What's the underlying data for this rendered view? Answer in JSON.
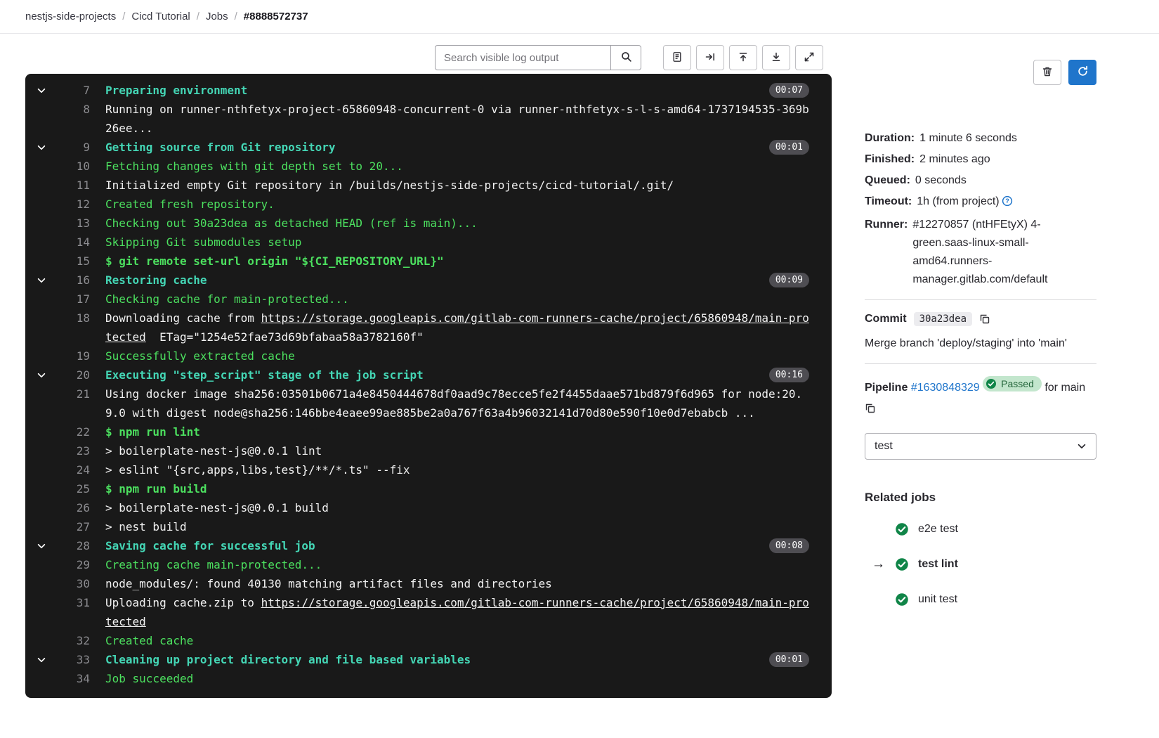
{
  "breadcrumb": {
    "items": [
      "nestjs-side-projects",
      "Cicd Tutorial",
      "Jobs"
    ],
    "current": "#8888572737",
    "separator": "/"
  },
  "log_toolbar": {
    "search_placeholder": "Search visible log output",
    "search_button_icon": "search-icon",
    "buttons": [
      {
        "name": "raw-log-button",
        "icon": "document-icon"
      },
      {
        "name": "show-complete-raw-button",
        "icon": "arrow-to-end-icon"
      },
      {
        "name": "scroll-to-top-button",
        "icon": "scroll-to-top-icon"
      },
      {
        "name": "scroll-to-bottom-button",
        "icon": "scroll-to-bottom-icon"
      },
      {
        "name": "fullscreen-button",
        "icon": "fullscreen-icon"
      }
    ]
  },
  "log": {
    "lines": [
      {
        "num": "7",
        "section": true,
        "duration": "00:07",
        "segments": [
          {
            "t": "Preparing environment",
            "s": "section"
          }
        ]
      },
      {
        "num": "8",
        "segments": [
          {
            "t": "Running on runner-nthfetyx-project-65860948-concurrent-0 via runner-nthfetyx-s-l-s-amd64-1737194535-369b26ee...",
            "s": "plain"
          }
        ]
      },
      {
        "num": "9",
        "section": true,
        "duration": "00:01",
        "segments": [
          {
            "t": "Getting source from Git repository",
            "s": "section"
          }
        ]
      },
      {
        "num": "10",
        "segments": [
          {
            "t": "Fetching changes with git depth set to 20...",
            "s": "green"
          }
        ]
      },
      {
        "num": "11",
        "segments": [
          {
            "t": "Initialized empty Git repository in /builds/nestjs-side-projects/cicd-tutorial/.git/",
            "s": "plain"
          }
        ]
      },
      {
        "num": "12",
        "segments": [
          {
            "t": "Created fresh repository.",
            "s": "green"
          }
        ]
      },
      {
        "num": "13",
        "segments": [
          {
            "t": "Checking out 30a23dea as detached HEAD (ref is main)...",
            "s": "green"
          }
        ]
      },
      {
        "num": "14",
        "segments": [
          {
            "t": "Skipping Git submodules setup",
            "s": "green"
          }
        ]
      },
      {
        "num": "15",
        "segments": [
          {
            "t": "$ git remote set-url origin \"${CI_REPOSITORY_URL}\"",
            "s": "cmd"
          }
        ]
      },
      {
        "num": "16",
        "section": true,
        "duration": "00:09",
        "segments": [
          {
            "t": "Restoring cache",
            "s": "section"
          }
        ]
      },
      {
        "num": "17",
        "segments": [
          {
            "t": "Checking cache for main-protected...",
            "s": "green"
          }
        ]
      },
      {
        "num": "18",
        "segments": [
          {
            "t": "Downloading cache from ",
            "s": "plain"
          },
          {
            "t": "https://storage.googleapis.com/gitlab-com-runners-cache/project/65860948/main-protected",
            "s": "link"
          },
          {
            "t": "  ETag=\"1254e52fae73d69bfabaa58a3782160f\"",
            "s": "plain"
          }
        ]
      },
      {
        "num": "19",
        "segments": [
          {
            "t": "Successfully extracted cache",
            "s": "green"
          }
        ]
      },
      {
        "num": "20",
        "section": true,
        "duration": "00:16",
        "segments": [
          {
            "t": "Executing \"step_script\" stage of the job script",
            "s": "section"
          }
        ]
      },
      {
        "num": "21",
        "segments": [
          {
            "t": "Using docker image sha256:03501b0671a4e8450444678df0aad9c78ecce5fe2f4455daae571bd879f6d965 for node:20.9.0 with digest node@sha256:146bbe4eaee99ae885be2a0a767f63a4b96032141d70d80e590f10e0d7ebabcb ...",
            "s": "plain"
          }
        ]
      },
      {
        "num": "22",
        "segments": [
          {
            "t": "$ npm run lint",
            "s": "cmd"
          }
        ]
      },
      {
        "num": "23",
        "segments": [
          {
            "t": "> boilerplate-nest-js@0.0.1 lint",
            "s": "plain"
          }
        ]
      },
      {
        "num": "24",
        "segments": [
          {
            "t": "> eslint \"{src,apps,libs,test}/**/*.ts\" --fix",
            "s": "plain"
          }
        ]
      },
      {
        "num": "25",
        "segments": [
          {
            "t": "$ npm run build",
            "s": "cmd"
          }
        ]
      },
      {
        "num": "26",
        "segments": [
          {
            "t": "> boilerplate-nest-js@0.0.1 build",
            "s": "plain"
          }
        ]
      },
      {
        "num": "27",
        "segments": [
          {
            "t": "> nest build",
            "s": "plain"
          }
        ]
      },
      {
        "num": "28",
        "section": true,
        "duration": "00:08",
        "segments": [
          {
            "t": "Saving cache for successful job",
            "s": "section"
          }
        ]
      },
      {
        "num": "29",
        "segments": [
          {
            "t": "Creating cache main-protected...",
            "s": "green"
          }
        ]
      },
      {
        "num": "30",
        "segments": [
          {
            "t": "node_modules/: found 40130 matching artifact files and directories",
            "s": "plain"
          }
        ]
      },
      {
        "num": "31",
        "segments": [
          {
            "t": "Uploading cache.zip to ",
            "s": "plain"
          },
          {
            "t": "https://storage.googleapis.com/gitlab-com-runners-cache/project/65860948/main-protected",
            "s": "link"
          }
        ]
      },
      {
        "num": "32",
        "segments": [
          {
            "t": "Created cache",
            "s": "green"
          }
        ]
      },
      {
        "num": "33",
        "section": true,
        "duration": "00:01",
        "segments": [
          {
            "t": "Cleaning up project directory and file based variables",
            "s": "section"
          }
        ]
      },
      {
        "num": "34",
        "segments": [
          {
            "t": "Job succeeded",
            "s": "green"
          }
        ]
      }
    ]
  },
  "sidebar": {
    "actions": [
      {
        "name": "erase-job-log-button",
        "icon": "trash-icon",
        "variant": "default"
      },
      {
        "name": "retry-job-button",
        "icon": "retry-icon",
        "variant": "primary"
      }
    ],
    "details": [
      {
        "label": "Duration:",
        "value": "1 minute 6 seconds"
      },
      {
        "label": "Finished:",
        "value": "2 minutes ago"
      },
      {
        "label": "Queued:",
        "value": "0 seconds"
      },
      {
        "label": "Timeout:",
        "value": "1h (from project)",
        "help_icon": true
      },
      {
        "label": "Runner:",
        "value": "#12270857 (ntHFEtyX) 4-green.saas-linux-small-amd64.runners-manager.gitlab.com/default"
      }
    ],
    "commit": {
      "label": "Commit",
      "sha": "30a23dea",
      "message": "Merge branch 'deploy/staging' into 'main'"
    },
    "pipeline": {
      "label": "Pipeline",
      "id": "#1630848329",
      "status": "Passed",
      "for_text": "for",
      "ref": "main"
    },
    "stage_selector": {
      "value": "test"
    },
    "related_jobs": {
      "title": "Related jobs",
      "jobs": [
        {
          "name": "e2e test",
          "status": "passed",
          "current": false
        },
        {
          "name": "test lint",
          "status": "passed",
          "current": true
        },
        {
          "name": "unit test",
          "status": "passed",
          "current": false
        }
      ]
    }
  },
  "colors": {
    "accent_blue": "#1f75cb",
    "success_green": "#108548",
    "badge_green_bg": "#c3e6cd",
    "log_section_teal": "#44d6b5",
    "log_green": "#4ce05f",
    "terminal_bg": "#191919"
  }
}
